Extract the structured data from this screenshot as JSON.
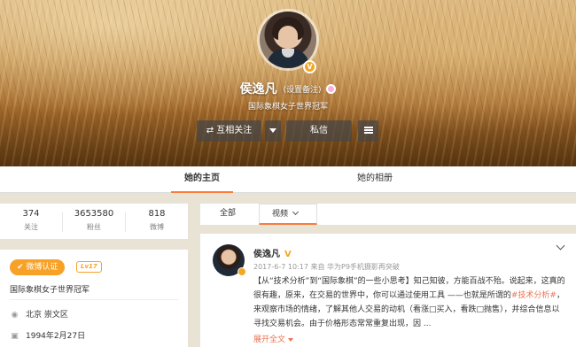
{
  "profile": {
    "name": "侯逸凡",
    "remark_label": "(设置备注)",
    "tagline": "国际象棋女子世界冠军",
    "verified_badge": "V",
    "buttons": {
      "follow": "⇄ 互相关注",
      "message": "私信"
    }
  },
  "tabs": {
    "home": "她的主页",
    "album": "她的相册"
  },
  "stats": [
    {
      "value": "374",
      "label": "关注"
    },
    {
      "value": "3653580",
      "label": "粉丝"
    },
    {
      "value": "818",
      "label": "微博"
    }
  ],
  "info": {
    "verify_label": "微博认证",
    "level": "Lv17",
    "description": "国际象棋女子世界冠军",
    "location": "北京 崇文区",
    "birthday": "1994年2月27日"
  },
  "feed_filter": {
    "all": "全部",
    "video": "视频"
  },
  "post": {
    "author": "侯逸凡",
    "verified": "V",
    "meta": "2017-6-7 10:17 来自 华为P9手机摄影再突破",
    "text_1": "【从“技术分析”到“国际象棋”的一些小思考】知己知彼，方能百战不殆。说起来，这真的很有趣，原来，在交易的世界中，你可以通过使用工具 ——也就是所谓的",
    "hashtag": "#技术分析#",
    "text_2": "，来观察市场的情绪，了解其他人交易的动机（看涨□买入，看跌□抛售），并综合信息以寻找交易机会。由于价格形态常常重复出现，因 ...",
    "expand": "展开全文"
  },
  "colors": {
    "accent": "#fa7d3c",
    "verified": "#f5a623",
    "link": "#eb7350"
  },
  "icons": [
    "exchange-icon",
    "chevron-down-icon",
    "menu-icon",
    "location-icon",
    "cake-icon",
    "verified-icon",
    "female-icon"
  ]
}
